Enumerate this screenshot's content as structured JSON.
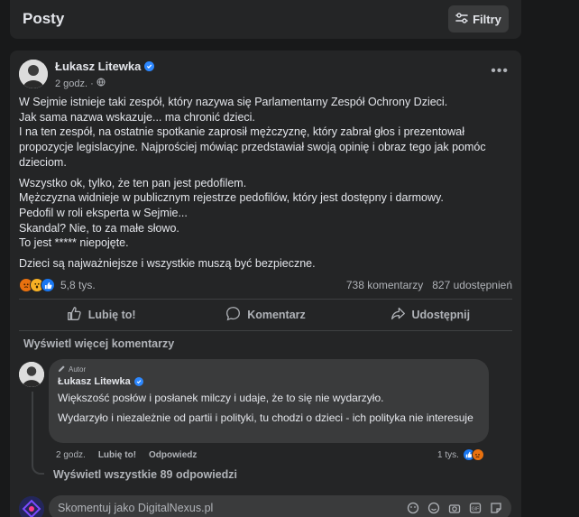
{
  "header": {
    "title": "Posty",
    "filter_label": "Filtry"
  },
  "post": {
    "author": "Łukasz Litewka",
    "time": "2 godz.",
    "paragraphs": [
      [
        "W Sejmie istnieje taki zespół, który nazywa się Parlamentarny Zespół Ochrony Dzieci.",
        "Jak sama nazwa wskazuje... ma chronić dzieci.",
        "I na ten zespół, na ostatnie spotkanie zaprosił mężczyznę, który zabrał głos i prezentował propozycje legislacyjne. Najprościej mówiąc przedstawiał swoją opinię i obraz tego jak pomóc dzieciom."
      ],
      [
        "Wszystko ok, tylko, że ten pan jest pedofilem.",
        "Mężczyzna widnieje w publicznym rejestrze pedofilów, który jest dostępny i darmowy.",
        "Pedofil w roli eksperta w Sejmie...",
        "Skandal? Nie, to za małe słowo.",
        "To jest ***** niepojęte."
      ],
      [
        "Dzieci są najważniejsze i wszystkie muszą być bezpieczne."
      ]
    ],
    "reactions_count": "5,8 tys.",
    "comments_count": "738 komentarzy",
    "shares_count": "827 udostępnień"
  },
  "actions": {
    "like": "Lubię to!",
    "comment": "Komentarz",
    "share": "Udostępnij"
  },
  "comments": {
    "more_label": "Wyświetl więcej komentarzy",
    "author_badge": "Autor",
    "author": "Łukasz Litewka",
    "text_1": "Większość posłów i posłanek milczy i udaje, że to się nie wydarzyło.",
    "text_2": "Wydarzyło i niezależnie od partii i polityki, tu chodzi o dzieci - ich polityka nie interesuje",
    "time": "2 godz.",
    "like": "Lubię to!",
    "reply": "Odpowiedz",
    "reactions_count": "1 tys.",
    "replies_link": "Wyświetl wszystkie 89 odpowiedzi"
  },
  "composer": {
    "placeholder": "Skomentuj jako DigitalNexus.pl"
  },
  "colors": {
    "background": "#18191a",
    "card": "#242526",
    "input": "#3a3b3c",
    "accent": "#2d88ff"
  }
}
